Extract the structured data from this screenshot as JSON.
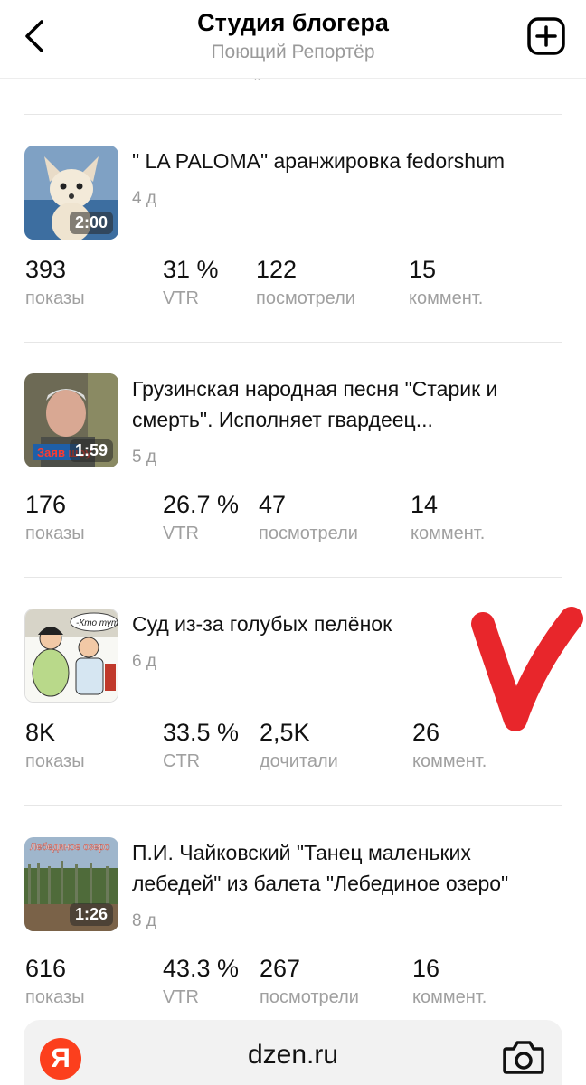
{
  "header": {
    "title": "Студия блогера",
    "subtitle": "Поющий Репортёр",
    "back_icon": "chevron-left-icon",
    "add_icon": "add-square-icon"
  },
  "cards": [
    {
      "title": "\" LA PALOMA\" аранжировка fedorshum",
      "age": "4 д",
      "duration": "2:00",
      "stats": [
        {
          "value": "393",
          "label": "показы"
        },
        {
          "value": "31 %",
          "label": "VTR"
        },
        {
          "value": "122",
          "label": "посмотрели"
        },
        {
          "value": "15",
          "label": "коммент."
        }
      ]
    },
    {
      "title": "Грузинская народная песня \"Старик и смерть\". Исполняет гвардеец...",
      "age": "5 д",
      "duration": "1:59",
      "thumb_text": "Заяв шоу",
      "stats": [
        {
          "value": "176",
          "label": "показы"
        },
        {
          "value": "26.7 %",
          "label": "VTR"
        },
        {
          "value": "47",
          "label": "посмотрели"
        },
        {
          "value": "14",
          "label": "коммент."
        }
      ]
    },
    {
      "title": "Суд из-за голубых пелёнок",
      "age": "6 д",
      "thumb_text": "-Кто тут?",
      "stats": [
        {
          "value": "8K",
          "label": "показы"
        },
        {
          "value": "33.5 %",
          "label": "CTR"
        },
        {
          "value": "2,5K",
          "label": "дочитали"
        },
        {
          "value": "26",
          "label": "коммент."
        }
      ]
    },
    {
      "title": "П.И. Чайковский \"Танец маленьких лебедей\" из балета \"Лебединое озеро\"",
      "age": "8 д",
      "duration": "1:26",
      "thumb_text": "Лебединое озеро",
      "stats": [
        {
          "value": "616",
          "label": "показы"
        },
        {
          "value": "43.3 %",
          "label": "VTR"
        },
        {
          "value": "267",
          "label": "посмотрели"
        },
        {
          "value": "16",
          "label": "коммент."
        }
      ]
    }
  ],
  "browser": {
    "logo": "Я",
    "url": "dzen.ru",
    "camera_icon": "camera-icon"
  },
  "colors": {
    "yandex_red": "#fc3f1d",
    "checkmark_red": "#e8262b",
    "label_gray": "#a0a0a0"
  }
}
